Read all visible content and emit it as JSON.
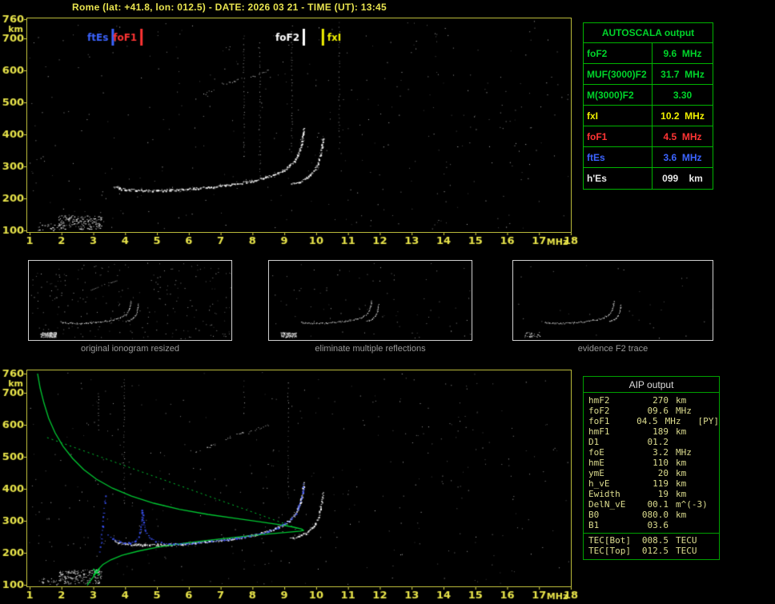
{
  "header": {
    "title": "Rome (lat: +41.8, lon: 012.5) - DATE: 2026 03 21 - TIME (UT): 13:45"
  },
  "autoscala": {
    "title": "AUTOSCALA output",
    "rows": [
      {
        "label": "foF2",
        "value": "9.6  MHz",
        "color": "#00d42a"
      },
      {
        "label": "MUF(3000)F2",
        "value": "31.7  MHz",
        "color": "#00d42a"
      },
      {
        "label": "M(3000)F2",
        "value": "3.30",
        "color": "#00d42a"
      },
      {
        "label": "fxI",
        "value": "10.2  MHz",
        "color": "#f0f000"
      },
      {
        "label": "foF1",
        "value": "4.5  MHz",
        "color": "#ff3434"
      },
      {
        "label": "ftEs",
        "value": "3.6  MHz",
        "color": "#3c64ff"
      },
      {
        "label": "h'Es",
        "value": "099    km",
        "color": "#e8e8e8"
      }
    ]
  },
  "aip": {
    "title": "AIP output",
    "rows": [
      {
        "label": "hmF2",
        "value": "270",
        "unit": "km",
        "note": ""
      },
      {
        "label": "foF2",
        "value": "09.6",
        "unit": "MHz",
        "note": ""
      },
      {
        "label": "foF1",
        "value": "04.5",
        "unit": "MHz",
        "note": "[PY]"
      },
      {
        "label": "hmF1",
        "value": "189",
        "unit": "km",
        "note": ""
      },
      {
        "label": "D1",
        "value": "01.2",
        "unit": "",
        "note": ""
      },
      {
        "label": "foE",
        "value": "3.2",
        "unit": "MHz",
        "note": ""
      },
      {
        "label": "hmE",
        "value": "110",
        "unit": "km",
        "note": ""
      },
      {
        "label": "ymE",
        "value": "20",
        "unit": "km",
        "note": ""
      },
      {
        "label": "h_vE",
        "value": "119",
        "unit": "km",
        "note": ""
      },
      {
        "label": "Ewidth",
        "value": "19",
        "unit": "km",
        "note": ""
      },
      {
        "label": "DelN_vE",
        "value": "00.1",
        "unit": "m^(-3)",
        "note": ""
      },
      {
        "label": "B0",
        "value": "080.0",
        "unit": "km",
        "note": ""
      },
      {
        "label": "B1",
        "value": "03.6",
        "unit": "",
        "note": ""
      }
    ],
    "tec_rows": [
      {
        "label": "TEC[Bot]",
        "value": "008.5",
        "unit": "TECU"
      },
      {
        "label": "TEC[Top]",
        "value": "012.5",
        "unit": "TECU"
      }
    ]
  },
  "thumbnails": [
    {
      "caption": "original ionogram resized"
    },
    {
      "caption": "eliminate multiple reflections"
    },
    {
      "caption": "evidence F2 trace"
    }
  ],
  "chart_data": {
    "type": "scatter",
    "title": "Ionogram, Rome, 2026-03-21 13:45 UT (virtual height vs frequency)",
    "xlabel": "MHz",
    "ylabel": "km",
    "xlim": [
      1,
      18
    ],
    "ylim": [
      100,
      760
    ],
    "xticks": [
      1,
      2,
      3,
      4,
      5,
      6,
      7,
      8,
      9,
      10,
      11,
      12,
      13,
      14,
      15,
      16,
      17,
      18
    ],
    "yticks": [
      100,
      200,
      300,
      400,
      500,
      600,
      700,
      760
    ],
    "axis_color": "#e8e44a",
    "critical_frequencies": [
      {
        "label": "ftEs",
        "mhz": 3.6,
        "color": "#3c64ff",
        "align": "left"
      },
      {
        "label": "foF1",
        "mhz": 4.5,
        "color": "#ff3434",
        "align": "left"
      },
      {
        "label": "foF2",
        "mhz": 9.6,
        "color": "#ffffff",
        "align": "left"
      },
      {
        "label": "fxI",
        "mhz": 10.2,
        "color": "#f0f000",
        "align": "right"
      }
    ],
    "traces": {
      "echo_color": "#ffffff",
      "f2_ordinary": [
        [
          3.65,
          238
        ],
        [
          3.8,
          232
        ],
        [
          4.0,
          229
        ],
        [
          4.3,
          227
        ],
        [
          4.6,
          226
        ],
        [
          5.0,
          226
        ],
        [
          5.4,
          227
        ],
        [
          5.8,
          229
        ],
        [
          6.2,
          232
        ],
        [
          6.6,
          236
        ],
        [
          7.0,
          240
        ],
        [
          7.4,
          246
        ],
        [
          7.8,
          252
        ],
        [
          8.1,
          258
        ],
        [
          8.4,
          266
        ],
        [
          8.7,
          276
        ],
        [
          8.95,
          288
        ],
        [
          9.15,
          302
        ],
        [
          9.3,
          318
        ],
        [
          9.42,
          338
        ],
        [
          9.5,
          360
        ],
        [
          9.55,
          382
        ],
        [
          9.58,
          402
        ],
        [
          9.6,
          420
        ]
      ],
      "f2_extraordinary": [
        [
          9.2,
          245
        ],
        [
          9.45,
          252
        ],
        [
          9.65,
          262
        ],
        [
          9.8,
          274
        ],
        [
          9.95,
          290
        ],
        [
          10.05,
          310
        ],
        [
          10.12,
          335
        ],
        [
          10.17,
          362
        ],
        [
          10.2,
          390
        ]
      ],
      "e_region_cluster": {
        "f_range": [
          1.9,
          3.25
        ],
        "h_range": [
          104,
          148
        ],
        "count": 160
      },
      "e_region_sparse": {
        "f_range": [
          1.25,
          2.0
        ],
        "h_range": [
          100,
          122
        ],
        "count": 25
      },
      "second_hop_segments": [
        [
          [
            6.2,
            515
          ],
          [
            6.8,
            540
          ]
        ],
        [
          [
            7.1,
            555
          ],
          [
            7.7,
            580
          ]
        ],
        [
          [
            7.9,
            580
          ],
          [
            8.5,
            600
          ]
        ]
      ],
      "fitted_color": "#3c55ff",
      "fitted_trace": [
        [
          3.45,
          255
        ],
        [
          3.6,
          245
        ],
        [
          3.8,
          237
        ],
        [
          4.0,
          232
        ],
        [
          4.15,
          232
        ],
        [
          4.3,
          238
        ],
        [
          4.4,
          252
        ],
        [
          4.47,
          275
        ],
        [
          4.5,
          305
        ],
        [
          4.52,
          335
        ],
        [
          4.56,
          295
        ],
        [
          4.62,
          268
        ],
        [
          4.75,
          248
        ],
        [
          4.95,
          238
        ],
        [
          5.2,
          231
        ],
        [
          5.5,
          229
        ],
        [
          5.9,
          230
        ],
        [
          6.3,
          233
        ],
        [
          6.7,
          237
        ],
        [
          7.1,
          241
        ],
        [
          7.5,
          247
        ],
        [
          7.9,
          254
        ],
        [
          8.2,
          261
        ],
        [
          8.5,
          269
        ],
        [
          8.8,
          280
        ],
        [
          9.0,
          292
        ],
        [
          9.2,
          306
        ],
        [
          9.35,
          324
        ],
        [
          9.45,
          345
        ],
        [
          9.52,
          368
        ],
        [
          9.57,
          392
        ],
        [
          9.6,
          415
        ]
      ],
      "fitted_foE_asymptote": [
        [
          3.2,
          205
        ],
        [
          3.24,
          245
        ],
        [
          3.28,
          285
        ],
        [
          3.31,
          325
        ],
        [
          3.34,
          360
        ],
        [
          3.36,
          380
        ]
      ],
      "profile_color": "#00c832",
      "density_profile": [
        [
          2.8,
          95
        ],
        [
          2.85,
          105
        ],
        [
          2.95,
          118
        ],
        [
          3.05,
          132
        ],
        [
          3.15,
          148
        ],
        [
          3.3,
          163
        ],
        [
          3.55,
          178
        ],
        [
          3.9,
          192
        ],
        [
          4.4,
          205
        ],
        [
          5.0,
          217
        ],
        [
          5.7,
          228
        ],
        [
          6.5,
          238
        ],
        [
          7.4,
          248
        ],
        [
          8.3,
          257
        ],
        [
          9.1,
          264
        ],
        [
          9.5,
          268
        ],
        [
          9.6,
          270
        ],
        [
          9.55,
          274
        ],
        [
          9.3,
          280
        ],
        [
          8.9,
          287
        ],
        [
          8.3,
          296
        ],
        [
          7.5,
          307
        ],
        [
          6.6,
          320
        ],
        [
          5.7,
          336
        ],
        [
          4.9,
          355
        ],
        [
          4.2,
          377
        ],
        [
          3.6,
          402
        ],
        [
          3.1,
          430
        ],
        [
          2.7,
          460
        ],
        [
          2.35,
          495
        ],
        [
          2.05,
          533
        ],
        [
          1.8,
          575
        ],
        [
          1.6,
          620
        ],
        [
          1.45,
          668
        ],
        [
          1.33,
          715
        ],
        [
          1.25,
          760
        ]
      ],
      "profile_dotted": [
        [
          1.55,
          560
        ],
        [
          9.45,
          275
        ]
      ],
      "hes_marker": {
        "mhz": 3.1,
        "km": 140,
        "color": "#00e040"
      }
    }
  }
}
